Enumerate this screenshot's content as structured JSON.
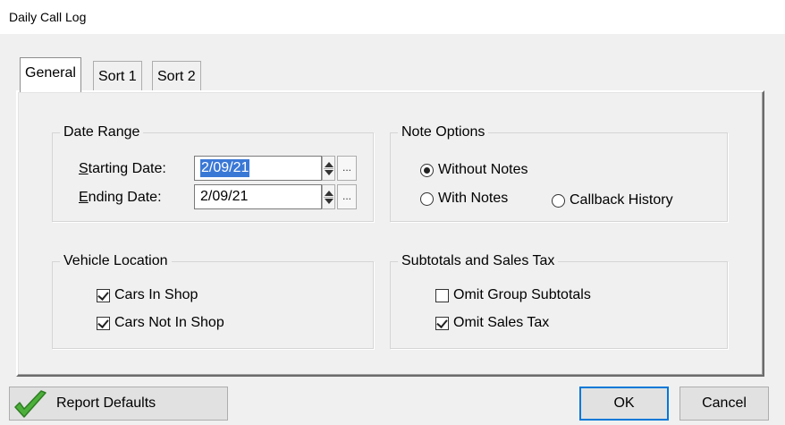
{
  "window": {
    "title": "Daily Call Log"
  },
  "tabs": [
    {
      "label": "General",
      "active": true
    },
    {
      "label": "Sort 1",
      "active": false
    },
    {
      "label": "Sort 2",
      "active": false
    }
  ],
  "date_range": {
    "title": "Date Range",
    "starting_label": "Starting Date:",
    "starting_accel": "S",
    "starting_rest": "tarting Date:",
    "starting_value": "2/09/21",
    "ending_label": "Ending Date:",
    "ending_accel": "E",
    "ending_rest": "nding Date:",
    "ending_value": "2/09/21",
    "picker_label": "..."
  },
  "note_options": {
    "title": "Note Options",
    "options": [
      {
        "label": "Without Notes",
        "selected": true
      },
      {
        "label": "With Notes",
        "selected": false
      },
      {
        "label": "Callback History",
        "selected": false
      }
    ]
  },
  "vehicle_location": {
    "title": "Vehicle Location",
    "options": [
      {
        "label": "Cars In Shop",
        "checked": true
      },
      {
        "label": "Cars Not In Shop",
        "checked": true
      }
    ]
  },
  "subtotals": {
    "title": "Subtotals and Sales Tax",
    "options": [
      {
        "label": "Omit Group Subtotals",
        "checked": false
      },
      {
        "label": "Omit Sales Tax",
        "checked": true
      }
    ]
  },
  "buttons": {
    "report_defaults": "Report Defaults",
    "ok": "OK",
    "cancel": "Cancel"
  },
  "colors": {
    "accent": "#0078d7",
    "selection": "#3a78d6",
    "check_green": "#4caf3a"
  }
}
